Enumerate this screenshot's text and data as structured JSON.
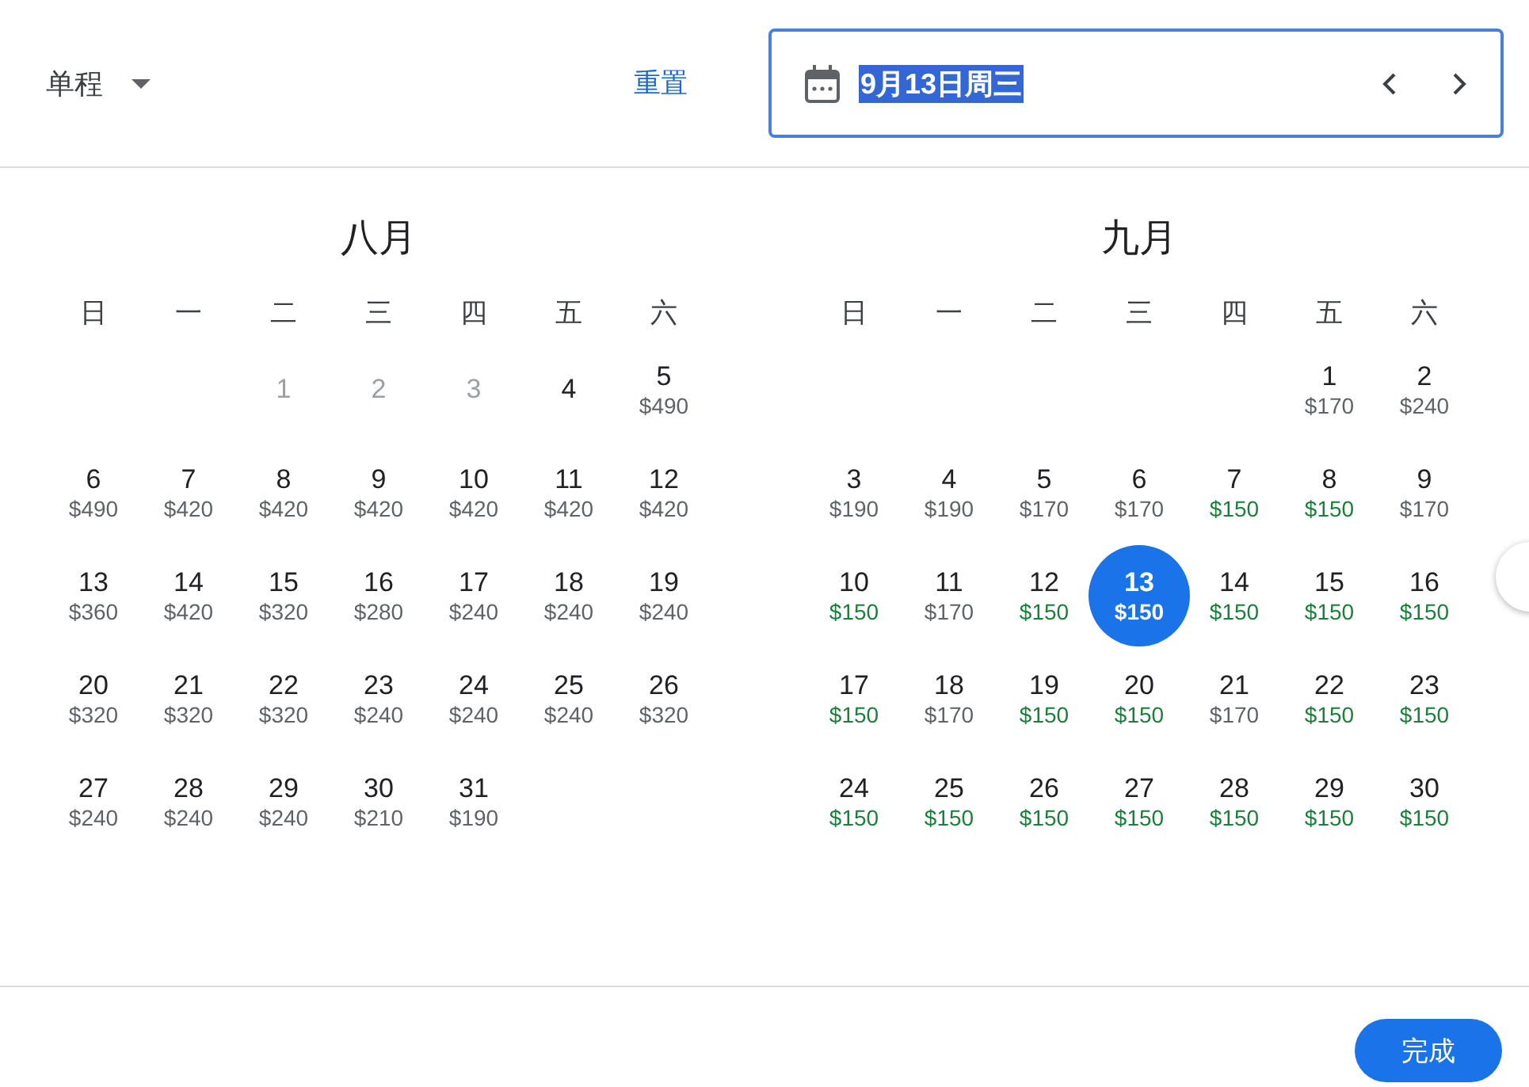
{
  "trip_type": {
    "label": "单程"
  },
  "reset_link": "重置",
  "date_field": {
    "value": "9月13日周三",
    "highlighted": true
  },
  "months": [
    {
      "title": "八月",
      "weekdays": [
        "日",
        "一",
        "二",
        "三",
        "四",
        "五",
        "六"
      ],
      "weeks": [
        [
          {
            "day": "1",
            "kind": "past",
            "selected": false
          },
          {
            "day": "2",
            "kind": "past",
            "selected": false
          },
          {
            "day": "3",
            "kind": "past",
            "selected": false
          },
          {
            "day": "4",
            "kind": "normal",
            "selected": false
          },
          {
            "day": "5",
            "price": "$490",
            "kind": "normal",
            "selected": false
          }
        ],
        [
          {
            "day": "6",
            "price": "$490",
            "kind": "normal",
            "selected": false
          },
          {
            "day": "7",
            "price": "$420",
            "kind": "normal",
            "selected": false
          },
          {
            "day": "8",
            "price": "$420",
            "kind": "normal",
            "selected": false
          },
          {
            "day": "9",
            "price": "$420",
            "kind": "normal",
            "selected": false
          },
          {
            "day": "10",
            "price": "$420",
            "kind": "normal",
            "selected": false
          },
          {
            "day": "11",
            "price": "$420",
            "kind": "normal",
            "selected": false
          },
          {
            "day": "12",
            "price": "$420",
            "kind": "normal",
            "selected": false
          }
        ],
        [
          {
            "day": "13",
            "price": "$360",
            "kind": "normal",
            "selected": false
          },
          {
            "day": "14",
            "price": "$420",
            "kind": "normal",
            "selected": false
          },
          {
            "day": "15",
            "price": "$320",
            "kind": "normal",
            "selected": false
          },
          {
            "day": "16",
            "price": "$280",
            "kind": "normal",
            "selected": false
          },
          {
            "day": "17",
            "price": "$240",
            "kind": "normal",
            "selected": false
          },
          {
            "day": "18",
            "price": "$240",
            "kind": "normal",
            "selected": false
          },
          {
            "day": "19",
            "price": "$240",
            "kind": "normal",
            "selected": false
          }
        ],
        [
          {
            "day": "20",
            "price": "$320",
            "kind": "normal",
            "selected": false
          },
          {
            "day": "21",
            "price": "$320",
            "kind": "normal",
            "selected": false
          },
          {
            "day": "22",
            "price": "$320",
            "kind": "normal",
            "selected": false
          },
          {
            "day": "23",
            "price": "$240",
            "kind": "normal",
            "selected": false
          },
          {
            "day": "24",
            "price": "$240",
            "kind": "normal",
            "selected": false
          },
          {
            "day": "25",
            "price": "$240",
            "kind": "normal",
            "selected": false
          },
          {
            "day": "26",
            "price": "$320",
            "kind": "normal",
            "selected": false
          }
        ],
        [
          {
            "day": "27",
            "price": "$240",
            "kind": "normal",
            "selected": false
          },
          {
            "day": "28",
            "price": "$240",
            "kind": "normal",
            "selected": false
          },
          {
            "day": "29",
            "price": "$240",
            "kind": "normal",
            "selected": false
          },
          {
            "day": "30",
            "price": "$210",
            "kind": "normal",
            "selected": false
          },
          {
            "day": "31",
            "price": "$190",
            "kind": "normal",
            "selected": false
          }
        ]
      ]
    },
    {
      "title": "九月",
      "weekdays": [
        "日",
        "一",
        "二",
        "三",
        "四",
        "五",
        "六"
      ],
      "weeks": [
        [
          {
            "day": "1",
            "price": "$170",
            "kind": "normal",
            "selected": false
          },
          {
            "day": "2",
            "price": "$240",
            "kind": "normal",
            "selected": false
          }
        ],
        [
          {
            "day": "3",
            "price": "$190",
            "kind": "normal",
            "selected": false
          },
          {
            "day": "4",
            "price": "$190",
            "kind": "normal",
            "selected": false
          },
          {
            "day": "5",
            "price": "$170",
            "kind": "normal",
            "selected": false
          },
          {
            "day": "6",
            "price": "$170",
            "kind": "normal",
            "selected": false
          },
          {
            "day": "7",
            "price": "$150",
            "kind": "low",
            "selected": false
          },
          {
            "day": "8",
            "price": "$150",
            "kind": "low",
            "selected": false
          },
          {
            "day": "9",
            "price": "$170",
            "kind": "normal",
            "selected": false
          }
        ],
        [
          {
            "day": "10",
            "price": "$150",
            "kind": "low",
            "selected": false
          },
          {
            "day": "11",
            "price": "$170",
            "kind": "normal",
            "selected": false
          },
          {
            "day": "12",
            "price": "$150",
            "kind": "low",
            "selected": false
          },
          {
            "day": "13",
            "price": "$150",
            "kind": "low",
            "selected": true
          },
          {
            "day": "14",
            "price": "$150",
            "kind": "low",
            "selected": false
          },
          {
            "day": "15",
            "price": "$150",
            "kind": "low",
            "selected": false
          },
          {
            "day": "16",
            "price": "$150",
            "kind": "low",
            "selected": false
          }
        ],
        [
          {
            "day": "17",
            "price": "$150",
            "kind": "low",
            "selected": false
          },
          {
            "day": "18",
            "price": "$170",
            "kind": "normal",
            "selected": false
          },
          {
            "day": "19",
            "price": "$150",
            "kind": "low",
            "selected": false
          },
          {
            "day": "20",
            "price": "$150",
            "kind": "low",
            "selected": false
          },
          {
            "day": "21",
            "price": "$170",
            "kind": "normal",
            "selected": false
          },
          {
            "day": "22",
            "price": "$150",
            "kind": "low",
            "selected": false
          },
          {
            "day": "23",
            "price": "$150",
            "kind": "low",
            "selected": false
          }
        ],
        [
          {
            "day": "24",
            "price": "$150",
            "kind": "low",
            "selected": false
          },
          {
            "day": "25",
            "price": "$150",
            "kind": "low",
            "selected": false
          },
          {
            "day": "26",
            "price": "$150",
            "kind": "low",
            "selected": false
          },
          {
            "day": "27",
            "price": "$150",
            "kind": "low",
            "selected": false
          },
          {
            "day": "28",
            "price": "$150",
            "kind": "low",
            "selected": false
          },
          {
            "day": "29",
            "price": "$150",
            "kind": "low",
            "selected": false
          },
          {
            "day": "30",
            "price": "$150",
            "kind": "low",
            "selected": false
          }
        ]
      ]
    }
  ],
  "done_button": "完成"
}
